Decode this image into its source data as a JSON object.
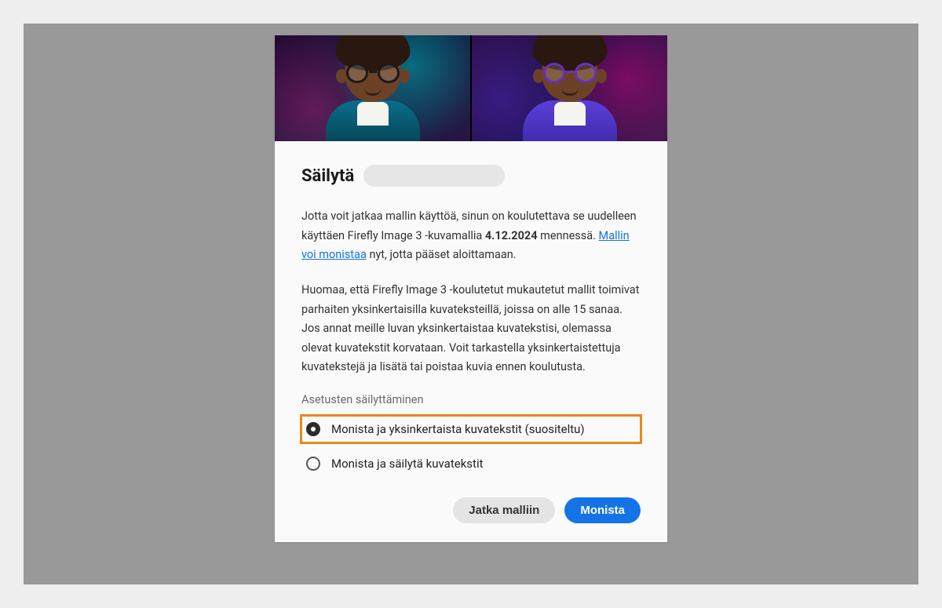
{
  "modal": {
    "title_prefix": "Säilytä",
    "paragraph1": {
      "pre": "Jotta voit jatkaa mallin käyttöä, sinun on koulutettava se uudelleen käyttäen Firefly Image 3 -kuvamallia ",
      "deadline": "4.12.2024",
      "mid": " mennessä. ",
      "link_text": "Mallin voi monistaa",
      "post": " nyt, jotta pääset aloittamaan."
    },
    "paragraph2": "Huomaa, että Firefly Image 3 -koulutetut mukautetut mallit toimivat parhaiten yksinkertaisilla kuvateksteillä, joissa on alle 15 sanaa. Jos annat meille luvan yksinkertaistaa kuvatekstisi, olemassa olevat kuvatekstit korvataan. Voit tarkastella yksinkertaistettuja kuvatekstejä ja lisätä tai poistaa kuvia ennen koulutusta.",
    "section_label": "Asetusten säilyttäminen",
    "options": [
      {
        "label": "Monista ja yksinkertaista kuvatekstit (suositeltu)",
        "checked": true,
        "highlighted": true
      },
      {
        "label": "Monista ja säilytä kuvatekstit",
        "checked": false,
        "highlighted": false
      }
    ],
    "actions": {
      "secondary": "Jatka malliin",
      "primary": "Monista"
    }
  }
}
